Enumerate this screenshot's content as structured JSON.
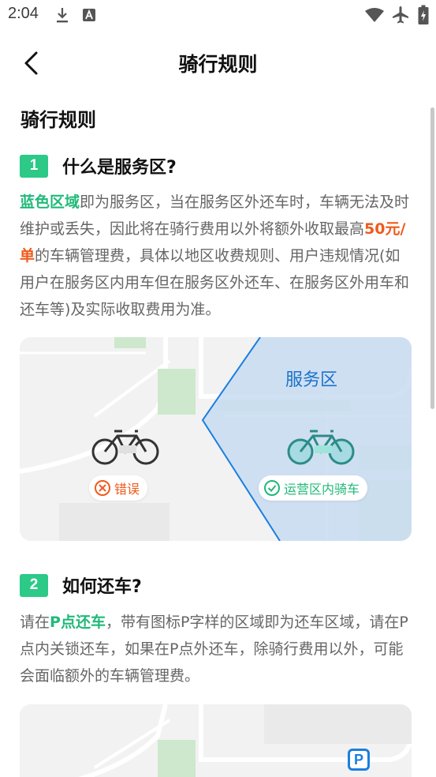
{
  "status_bar": {
    "time": "2:04",
    "icons": [
      "download-icon",
      "keyboard-a-icon",
      "wifi-icon",
      "airplane-icon",
      "battery-charging-icon"
    ]
  },
  "header": {
    "title": "骑行规则",
    "back_icon": "chevron-left-icon"
  },
  "section": {
    "title": "骑行规则"
  },
  "q1": {
    "number": "1",
    "title": "什么是服务区?",
    "body": {
      "highlight_blue_zone": "蓝色区域",
      "part1": "即为服务区，当在服务区外还车时，车辆无法及时维护或丢失，因此将在骑行费用以外将额外收取最高",
      "fee": "50元/单",
      "part2": "的车辆管理费，具体以地区收费规则、用户违规情况(如用户在服务区内用车但在服务区外还车、在服务区外用车和还车等)及实际收取费用为准。"
    },
    "map": {
      "zone_label": "服务区",
      "wrong_label": "错误",
      "right_label": "运营区内骑车",
      "wrong_icon": "x-circle-icon",
      "right_icon": "check-circle-icon",
      "bike_icon": "bicycle-icon",
      "zone_color": "#c9dcf2",
      "zone_border": "#1a7fe0"
    }
  },
  "q2": {
    "number": "2",
    "title": "如何还车?",
    "body": {
      "part1": "请在",
      "highlight": "P点还车",
      "part2": "，带有图标P字样的区域即为还车区域，请在P点内关锁还车，如果在P点外还车，除骑行费用以外，可能会面临额外的车辆管理费。"
    },
    "map": {
      "parking_label": "P",
      "parking_icon": "parking-pin-icon"
    }
  },
  "colors": {
    "accent_green": "#2cc987",
    "highlight_orange": "#f05a1c",
    "zone_blue": "#1a73c8"
  }
}
